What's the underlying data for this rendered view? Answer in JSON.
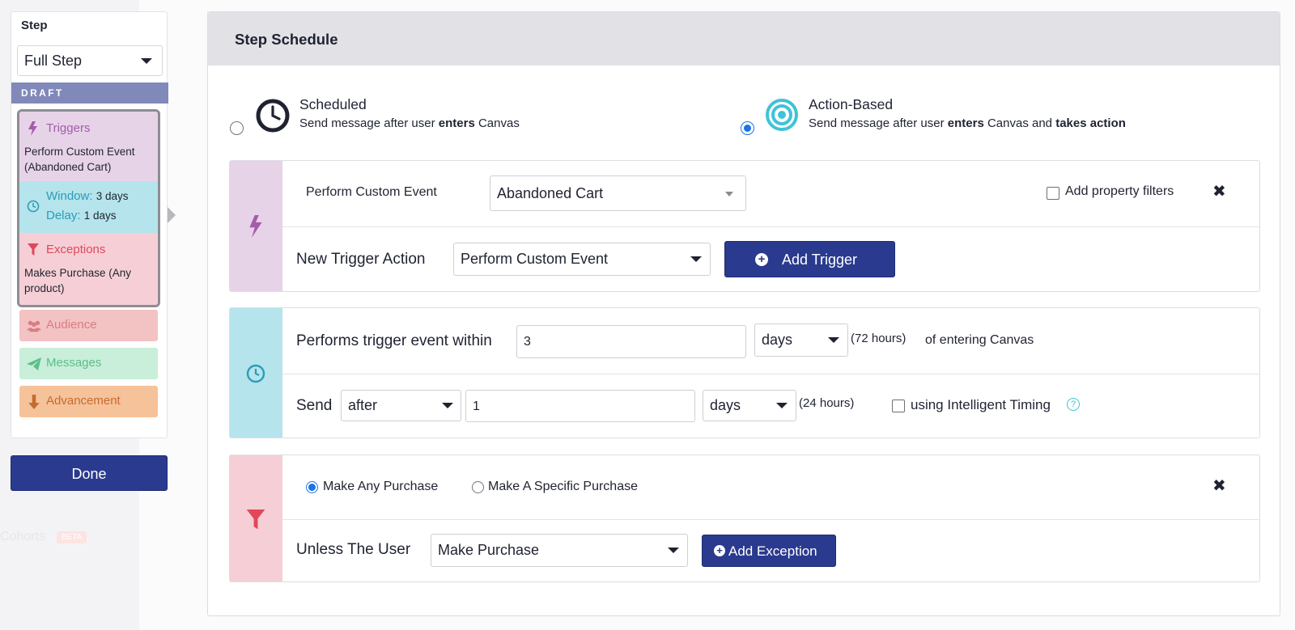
{
  "sidebar": {
    "step_label": "Step",
    "step_select_value": "Full Step",
    "draft_label": "DRAFT",
    "triggers": {
      "title": "Triggers",
      "text": "Perform Custom Event (Abandoned Cart)"
    },
    "window": {
      "window_label": "Window:",
      "window_value": "3 days",
      "delay_label": "Delay:",
      "delay_value": "1 days"
    },
    "exceptions": {
      "title": "Exceptions",
      "text": "Makes Purchase (Any product)"
    },
    "audience_label": "Audience",
    "messages_label": "Messages",
    "advancement_label": "Advancement",
    "done_label": "Done"
  },
  "background": {
    "cohorts_label": "Cohorts",
    "beta_badge": "BETA"
  },
  "modal": {
    "title": "Step Schedule",
    "scheduled": {
      "title": "Scheduled",
      "sub_prefix": "Send message after user",
      "sub_bold": "enters",
      "sub_suffix": "Canvas",
      "selected": false
    },
    "action_based": {
      "title": "Action-Based",
      "sub_prefix": "Send message after user",
      "sub_bold1": "enters",
      "sub_mid": "Canvas and",
      "sub_bold2": "takes action",
      "selected": true
    }
  },
  "triggers_section": {
    "event_label": "Perform Custom Event",
    "event_value": "Abandoned Cart",
    "property_filters_label": "Add property filters",
    "new_trigger_label": "New Trigger Action",
    "new_trigger_value": "Perform Custom Event",
    "add_trigger_label": "Add Trigger"
  },
  "window_section": {
    "performs_label": "Performs trigger event within",
    "window_value": "3",
    "window_unit": "days",
    "window_hours": "(72 hours)",
    "window_suffix": "of entering Canvas",
    "send_label": "Send",
    "send_mode": "after",
    "send_value": "1",
    "send_unit": "days",
    "send_hours": "(24 hours)",
    "intelligent_timing_label": "using Intelligent Timing",
    "help_glyph": "?"
  },
  "exceptions_section": {
    "any_purchase_label": "Make Any Purchase",
    "specific_purchase_label": "Make A Specific Purchase",
    "unless_label": "Unless The User",
    "unless_value": "Make Purchase",
    "add_exception_label": "Add Exception"
  },
  "colors": {
    "primary": "#2a3a8e",
    "triggers": "#e7d3e8",
    "window": "#b5e4ec",
    "exceptions": "#f6cfd6",
    "audience": "#f3c3c4",
    "messages": "#c9eed9",
    "advancement": "#f6c299"
  }
}
